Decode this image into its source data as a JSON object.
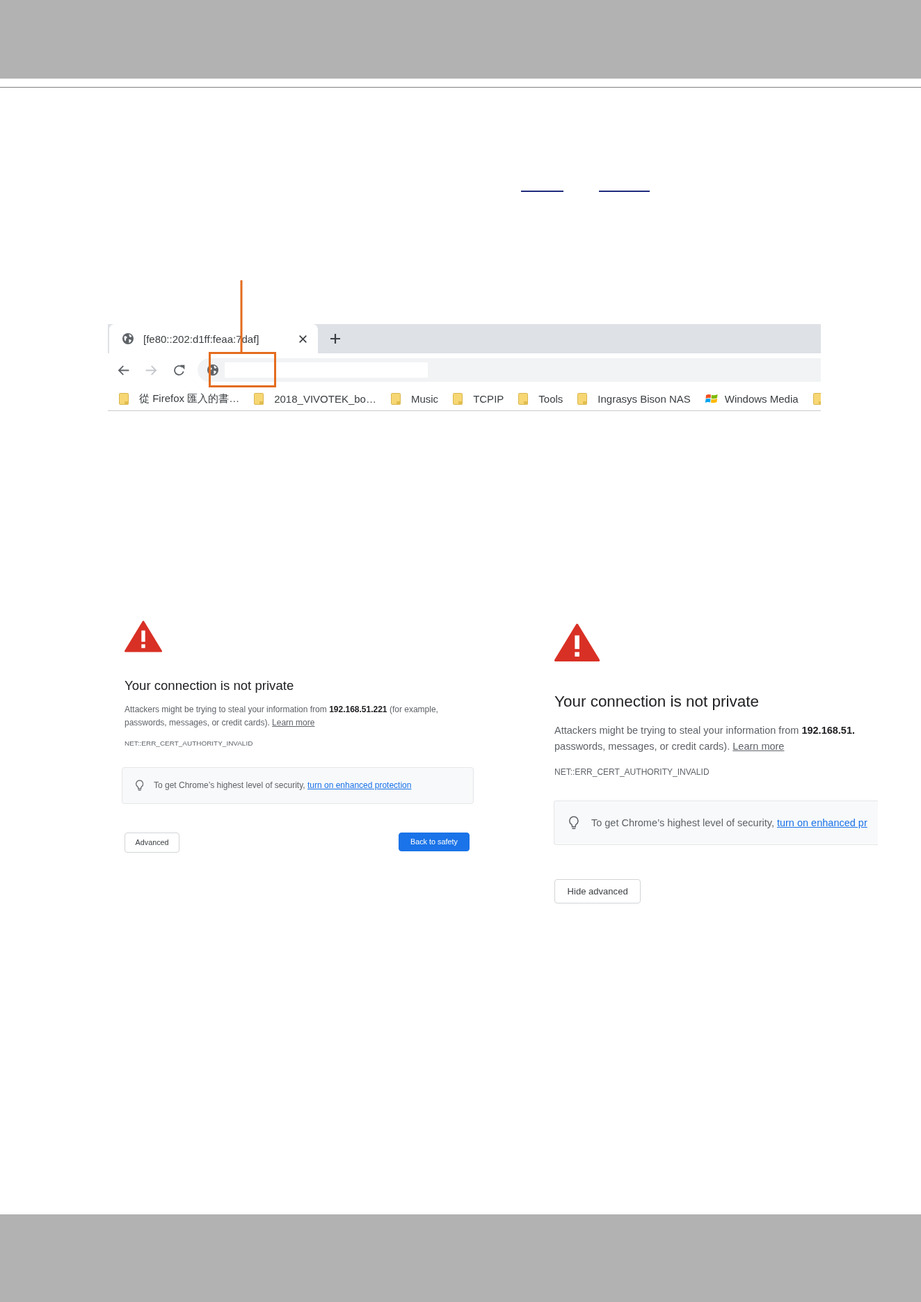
{
  "browser": {
    "tab": {
      "title": "[fe80::202:d1ff:feaa:7daf]",
      "selected": true
    },
    "nav_buttons": [
      {
        "kind": "back",
        "disabled": false
      },
      {
        "kind": "forward",
        "disabled": true
      },
      {
        "kind": "reload",
        "disabled": false
      }
    ],
    "bookmarks": [
      {
        "kind": "folder",
        "label": "從 Firefox 匯入的書…"
      },
      {
        "kind": "folder",
        "label": "2018_VIVOTEK_bo…"
      },
      {
        "kind": "folder",
        "label": "Music"
      },
      {
        "kind": "folder",
        "label": "TCPIP"
      },
      {
        "kind": "folder",
        "label": "Tools"
      },
      {
        "kind": "folder",
        "label": "Ingrasys Bison NAS"
      },
      {
        "kind": "app",
        "label": "Windows Media"
      },
      {
        "kind": "folder"
      }
    ]
  },
  "error_pages": [
    {
      "title": "Your connection is not private",
      "description_lines": [
        "Attackers might be trying to steal your information from **192.168.51.221** (for example,",
        "passwords, messages, or credit cards)."
      ],
      "learn_more": "Learn more",
      "error_code": "NET::ERR_CERT_AUTHORITY_INVALID",
      "tip": {
        "text": "To get Chrome’s highest level of security,",
        "link": "turn on enhanced protection"
      },
      "buttons": [
        {
          "kind": "advanced_toggle",
          "label": "Advanced"
        },
        {
          "kind": "back_to_safety",
          "label": "Back to safety"
        }
      ]
    },
    {
      "title": "Your connection is not private",
      "description_lines": [
        "Attackers might be trying to steal your information from **192.168.51.**",
        "passwords, messages, or credit cards)."
      ],
      "learn_more": "Learn more",
      "error_code": "NET::ERR_CERT_AUTHORITY_INVALID",
      "tip": {
        "text": "To get Chrome’s highest level of security,",
        "link": "turn on enhanced pr"
      },
      "buttons": [
        {
          "kind": "advanced_toggle",
          "label": "Hide advanced"
        }
      ]
    }
  ]
}
